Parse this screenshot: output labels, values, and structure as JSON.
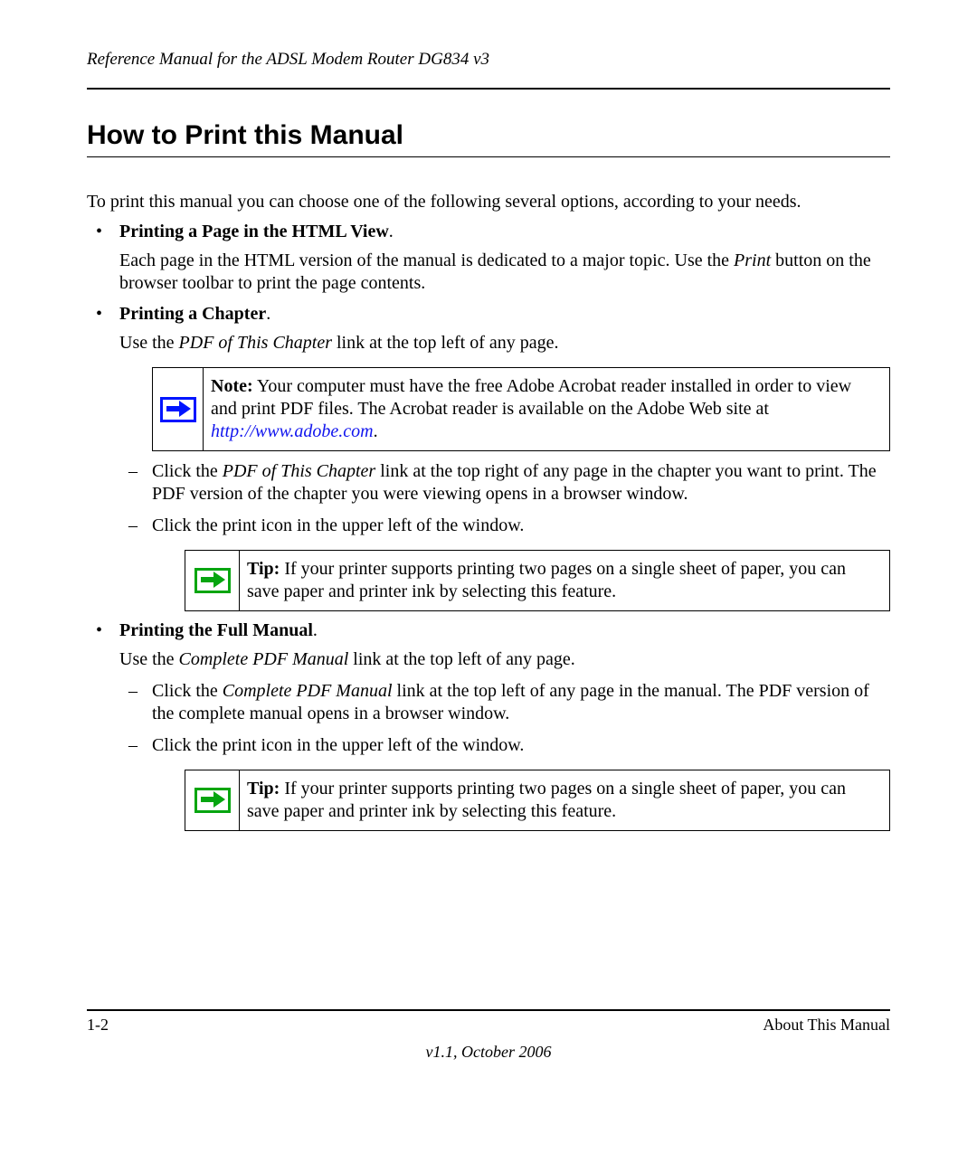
{
  "header": {
    "running": "Reference Manual for the ADSL Modem Router DG834 v3"
  },
  "section_title": "How to Print this Manual",
  "intro": "To print this manual you can choose one of the following several options, according to your needs.",
  "bullets": {
    "b1": {
      "head": "Printing a Page in the HTML View",
      "p_before": "Each page in the HTML version of the manual is dedicated to a major topic. Use the ",
      "p_italic": "Print",
      "p_after": " button on the browser toolbar to print the page contents."
    },
    "b2": {
      "head": "Printing a Chapter",
      "p_before": "Use the ",
      "p_italic": "PDF of This Chapter",
      "p_after": " link at the top left of any page.",
      "note": {
        "lead": "Note:",
        "text_before": " Your computer must have the free Adobe Acrobat reader installed in order to view and print PDF files. The Acrobat reader is available on the Adobe Web site at ",
        "link_text": "http://www.adobe.com",
        "text_after": "."
      },
      "sub1": {
        "before": "Click the ",
        "italic": "PDF of This Chapter",
        "after": " link at the top right of any page in the chapter you want to print. The PDF version of the chapter you were viewing opens in a browser window."
      },
      "sub2": "Click the print icon in the upper left of the window.",
      "tip": {
        "lead": "Tip:",
        "text": " If your printer supports printing two pages on a single sheet of paper, you can save paper and printer ink by selecting this feature."
      }
    },
    "b3": {
      "head": "Printing the Full Manual",
      "p_before": "Use the ",
      "p_italic": "Complete PDF Manual",
      "p_after": " link at the top left of any page.",
      "sub1": {
        "before": "Click the ",
        "italic": "Complete PDF Manual",
        "after": " link at the top left of any page in the manual. The PDF version of the complete manual opens in a browser window."
      },
      "sub2": "Click the print icon in the upper left of the window.",
      "tip": {
        "lead": "Tip:",
        "text": " If your printer supports printing two pages on a single sheet of paper, you can save paper and printer ink by selecting this feature."
      }
    }
  },
  "footer": {
    "page_number": "1-2",
    "section": "About This Manual",
    "version": "v1.1, October 2006"
  }
}
